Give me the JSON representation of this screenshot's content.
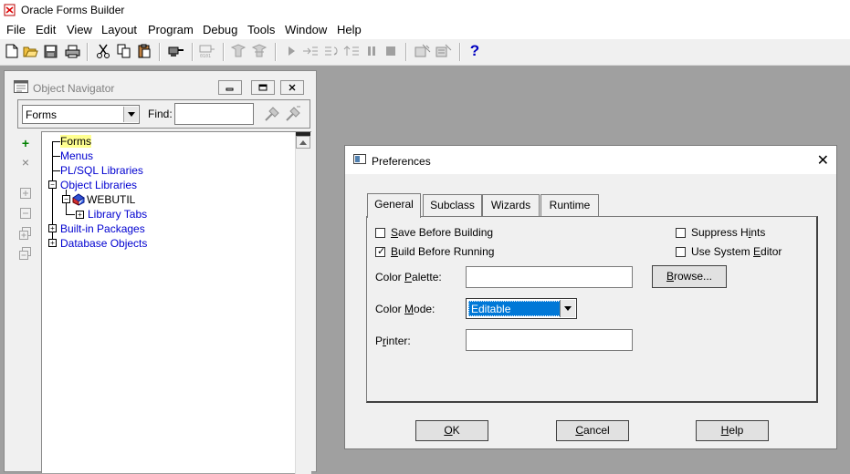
{
  "app": {
    "title": "Oracle Forms Builder"
  },
  "menu": [
    "File",
    "Edit",
    "View",
    "Layout",
    "Program",
    "Debug",
    "Tools",
    "Window",
    "Help"
  ],
  "toolbar": {
    "help_glyph": "?"
  },
  "navigator": {
    "title": "Object Navigator",
    "combo_value": "Forms",
    "find_label": "Find:",
    "find_value": "",
    "tree": {
      "forms": "Forms",
      "menus": "Menus",
      "plsql": "PL/SQL Libraries",
      "objlibs": "Object Libraries",
      "webutil": "WEBUTIL",
      "libtabs": "Library Tabs",
      "builtins": "Built-in Packages",
      "dbobjects": "Database Objects"
    }
  },
  "prefs": {
    "title": "Preferences",
    "tabs": [
      "General",
      "Subclass",
      "Wizards",
      "Runtime"
    ],
    "selected_tab": "General",
    "save_before_building": {
      "label_pre": "",
      "accel": "S",
      "label_post": "ave Before Building",
      "checked": false
    },
    "build_before_running": {
      "label_pre": "",
      "accel": "B",
      "label_post": "uild Before Running",
      "checked": true
    },
    "suppress_hints": {
      "label_pre": "Suppress H",
      "accel": "i",
      "label_post": "nts",
      "checked": false
    },
    "use_system_editor": {
      "label_pre": "Use System ",
      "accel": "E",
      "label_post": "ditor",
      "checked": false
    },
    "color_palette": {
      "label_pre": "Color ",
      "accel": "P",
      "label_post": "alette:",
      "value": ""
    },
    "color_mode": {
      "label_pre": "Color ",
      "accel": "M",
      "label_post": "ode:",
      "value": "Editable"
    },
    "printer": {
      "label_pre": "P",
      "accel": "r",
      "label_post": "inter:",
      "value": ""
    },
    "browse": {
      "label_pre": "",
      "accel": "B",
      "label_post": "rowse..."
    },
    "ok": {
      "label_pre": "",
      "accel": "O",
      "label_post": "K"
    },
    "cancel": {
      "label_pre": "",
      "accel": "C",
      "label_post": "ancel"
    },
    "help": {
      "label_pre": "",
      "accel": "H",
      "label_post": "elp"
    }
  }
}
